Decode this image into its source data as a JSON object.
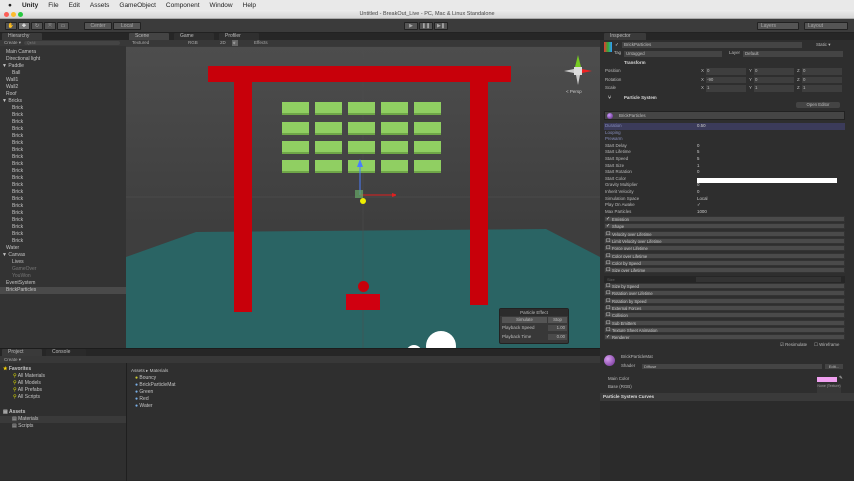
{
  "menubar": {
    "apple": "",
    "app": "Unity",
    "items": [
      "File",
      "Edit",
      "Assets",
      "GameObject",
      "Component",
      "Window",
      "Help"
    ]
  },
  "window_title": "Untitled - BreakOut_Live - PC, Mac & Linux Standalone",
  "toolbar": {
    "pivot": "Center",
    "space": "Local",
    "layers": "Layers",
    "layout": "Layout",
    "play": "▶",
    "pause": "❚❚",
    "step": "▶❚"
  },
  "hierarchy": {
    "tab": "Hierarchy",
    "create": "Create ▾",
    "search_placeholder": "Q▾All",
    "items": [
      {
        "label": "Main Camera",
        "indent": 1
      },
      {
        "label": "Directional light",
        "indent": 1
      },
      {
        "label": "▼ Paddle",
        "indent": 0
      },
      {
        "label": "Ball",
        "indent": 2
      },
      {
        "label": "Wall1",
        "indent": 1
      },
      {
        "label": "Wall2",
        "indent": 1
      },
      {
        "label": "Roof",
        "indent": 1
      },
      {
        "label": "▼ Bricks",
        "indent": 0
      },
      {
        "label": "Brick",
        "indent": 2
      },
      {
        "label": "Brick",
        "indent": 2
      },
      {
        "label": "Brick",
        "indent": 2
      },
      {
        "label": "Brick",
        "indent": 2
      },
      {
        "label": "Brick",
        "indent": 2
      },
      {
        "label": "Brick",
        "indent": 2
      },
      {
        "label": "Brick",
        "indent": 2
      },
      {
        "label": "Brick",
        "indent": 2
      },
      {
        "label": "Brick",
        "indent": 2
      },
      {
        "label": "Brick",
        "indent": 2
      },
      {
        "label": "Brick",
        "indent": 2
      },
      {
        "label": "Brick",
        "indent": 2
      },
      {
        "label": "Brick",
        "indent": 2
      },
      {
        "label": "Brick",
        "indent": 2
      },
      {
        "label": "Brick",
        "indent": 2
      },
      {
        "label": "Brick",
        "indent": 2
      },
      {
        "label": "Brick",
        "indent": 2
      },
      {
        "label": "Brick",
        "indent": 2
      },
      {
        "label": "Brick",
        "indent": 2
      },
      {
        "label": "Brick",
        "indent": 2
      },
      {
        "label": "Water",
        "indent": 1
      },
      {
        "label": "▼ Canvas",
        "indent": 0
      },
      {
        "label": "Lives",
        "indent": 2
      },
      {
        "label": "GameOver",
        "indent": 2,
        "dim": true
      },
      {
        "label": "YouWon",
        "indent": 2,
        "dim": true
      },
      {
        "label": "EventSystem",
        "indent": 1
      },
      {
        "label": "BrickParticles",
        "indent": 1,
        "selected": true
      }
    ]
  },
  "scene": {
    "tabs": [
      "Scene",
      "Game",
      "Profiler"
    ],
    "shading": "Textured",
    "render": "RGB",
    "mode2d": "2D",
    "effects": "Effects",
    "persp": "< Persp"
  },
  "particle_effect": {
    "title": "Particle Effect",
    "simulate": "Simulate",
    "stop": "Stop",
    "speed_label": "Playback Speed",
    "speed": "1.00",
    "time_label": "Playback Time",
    "time": "0.00"
  },
  "inspector": {
    "tab": "Inspector",
    "name": "BrickParticles",
    "static": "Static ▾",
    "tag_label": "Tag",
    "tag": "Untagged",
    "layer_label": "Layer",
    "layer": "Default",
    "transform": {
      "title": "Transform",
      "rows": [
        {
          "label": "Position",
          "x": "0",
          "y": "0",
          "z": "0"
        },
        {
          "label": "Rotation",
          "x": "-90",
          "y": "0",
          "z": "0"
        },
        {
          "label": "Scale",
          "x": "1",
          "y": "1",
          "z": "1"
        }
      ]
    },
    "particle_system": {
      "title": "Particle System",
      "open_editor": "Open Editor",
      "module": "BrickParticles",
      "props": [
        {
          "label": "Duration",
          "value": "0.50"
        },
        {
          "label": "Looping",
          "value": ""
        },
        {
          "label": "Prewarm",
          "value": ""
        },
        {
          "label": "Start Delay",
          "value": "0"
        },
        {
          "label": "Start Lifetime",
          "value": "5"
        },
        {
          "label": "Start Speed",
          "value": "5"
        },
        {
          "label": "Start Size",
          "value": "1"
        },
        {
          "label": "Start Rotation",
          "value": "0"
        },
        {
          "label": "Start Color",
          "value": ""
        },
        {
          "label": "Gravity Multiplier",
          "value": "0"
        },
        {
          "label": "Inherit Velocity",
          "value": "0"
        },
        {
          "label": "Simulation Space",
          "value": "Local"
        },
        {
          "label": "Play On Awake",
          "value": "✓"
        },
        {
          "label": "Max Particles",
          "value": "1000"
        }
      ],
      "modules_a": [
        {
          "label": "Emission",
          "on": true
        },
        {
          "label": "Shape",
          "on": true
        },
        {
          "label": "Velocity over Lifetime"
        },
        {
          "label": "Limit Velocity over Lifetime"
        },
        {
          "label": "Force over Lifetime"
        },
        {
          "label": "Color over Lifetime"
        },
        {
          "label": "Color by Speed"
        },
        {
          "label": "Size over Lifetime"
        }
      ],
      "size_label": "Size",
      "modules_b": [
        {
          "label": "Size by Speed"
        },
        {
          "label": "Rotation over Lifetime"
        },
        {
          "label": "Rotation by Speed"
        },
        {
          "label": "External Forces"
        },
        {
          "label": "Collision"
        },
        {
          "label": "Sub Emitters"
        },
        {
          "label": "Texture Sheet Animation"
        },
        {
          "label": "Renderer",
          "on": true
        }
      ],
      "resimulate": "Resimulate",
      "wireframe": "Wireframe"
    },
    "material": {
      "name": "BrickParticleMat",
      "shader_label": "Shader",
      "shader": "Diffuse",
      "edit": "Edit...",
      "main_color": "Main Color",
      "base": "Base (RGB)",
      "none_texture": "None (Texture)",
      "color": "#f0a0f0"
    },
    "curves": "Particle System Curves"
  },
  "project": {
    "tabs": [
      "Project",
      "Console"
    ],
    "create": "Create ▾",
    "favorites": "Favorites",
    "fav_items": [
      "All Materials",
      "All Models",
      "All Prefabs",
      "All Scripts"
    ],
    "assets": "Assets",
    "folders": [
      "Materials",
      "Scripts"
    ],
    "breadcrumb": "Assets ▸ Materials",
    "files": [
      "Bouncy",
      "BrickParticleMat",
      "Green",
      "Red",
      "Water"
    ]
  }
}
